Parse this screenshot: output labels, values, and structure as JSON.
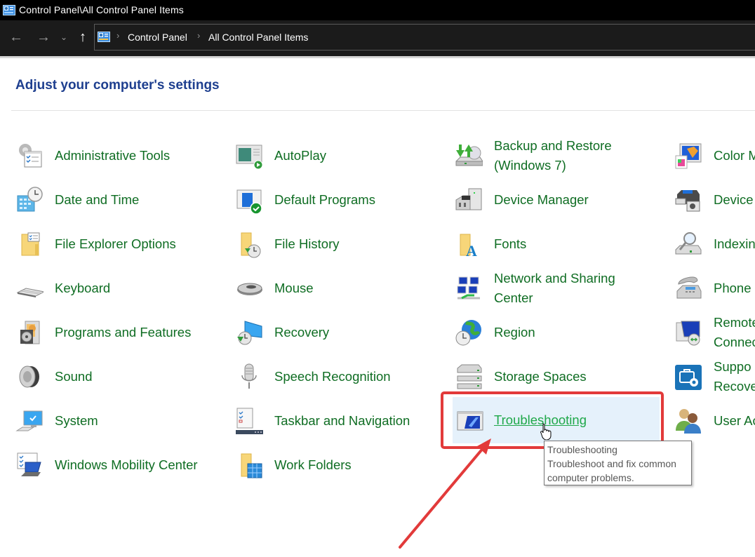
{
  "window": {
    "title": "Control Panel\\All Control Panel Items"
  },
  "nav": {
    "back_icon": "arrow-left-icon",
    "forward_icon": "arrow-right-icon",
    "recent_icon": "chevron-down-icon",
    "up_icon": "arrow-up-icon",
    "back_glyph": "←",
    "forward_glyph": "→",
    "recent_glyph": "⌄",
    "up_glyph": "↑"
  },
  "breadcrumb": {
    "separator": "›",
    "items": [
      "Control Panel",
      "All Control Panel Items"
    ]
  },
  "page": {
    "heading": "Adjust your computer's settings"
  },
  "items": [
    {
      "label": "Administrative Tools",
      "icon": "admin-tools-icon"
    },
    {
      "label": "Date and Time",
      "icon": "date-time-icon"
    },
    {
      "label": "File Explorer Options",
      "icon": "file-explorer-options-icon"
    },
    {
      "label": "Keyboard",
      "icon": "keyboard-icon"
    },
    {
      "label": "Programs and Features",
      "icon": "programs-features-icon"
    },
    {
      "label": "Sound",
      "icon": "sound-icon"
    },
    {
      "label": "System",
      "icon": "system-icon"
    },
    {
      "label": "Windows Mobility Center",
      "icon": "mobility-center-icon"
    },
    {
      "label": "AutoPlay",
      "icon": "autoplay-icon"
    },
    {
      "label": "Default Programs",
      "icon": "default-programs-icon"
    },
    {
      "label": "File History",
      "icon": "file-history-icon"
    },
    {
      "label": "Mouse",
      "icon": "mouse-icon"
    },
    {
      "label": "Recovery",
      "icon": "recovery-icon"
    },
    {
      "label": "Speech Recognition",
      "icon": "microphone-icon"
    },
    {
      "label": "Taskbar and Navigation",
      "icon": "taskbar-icon"
    },
    {
      "label": "Work Folders",
      "icon": "work-folders-icon"
    },
    {
      "label": "Backup and Restore",
      "label2": "(Windows 7)",
      "icon": "backup-restore-icon"
    },
    {
      "label": "Device Manager",
      "icon": "device-manager-icon"
    },
    {
      "label": "Fonts",
      "icon": "fonts-icon"
    },
    {
      "label": "Network and Sharing",
      "label2": "Center",
      "icon": "network-icon"
    },
    {
      "label": "Region",
      "icon": "region-globe-icon"
    },
    {
      "label": "Storage Spaces",
      "icon": "storage-spaces-icon"
    },
    {
      "label": "Troubleshooting",
      "icon": "troubleshooting-icon"
    },
    {
      "label": "Color M",
      "icon": "color-management-icon"
    },
    {
      "label": "Device",
      "icon": "devices-printers-icon"
    },
    {
      "label": "Indexin",
      "icon": "indexing-icon"
    },
    {
      "label": "Phone",
      "icon": "phone-modem-icon"
    },
    {
      "label": "Remote",
      "label2": "Connec",
      "icon": "remoteapp-icon"
    },
    {
      "label": "Suppo",
      "label2": "Recove",
      "icon": "support-recovery-icon"
    },
    {
      "label": "User Ac",
      "icon": "user-accounts-icon"
    }
  ],
  "tooltip": {
    "title": "Troubleshooting",
    "line1": "Troubleshoot and fix common",
    "line2": "computer problems."
  },
  "annotation": {
    "highlight_color": "#e23a3a",
    "target": "Troubleshooting"
  },
  "colors": {
    "link_green": "#0f6d23",
    "hover_green": "#1fa84a",
    "heading_blue": "#1e3f8f",
    "selected_bg": "#e5f1fb"
  }
}
